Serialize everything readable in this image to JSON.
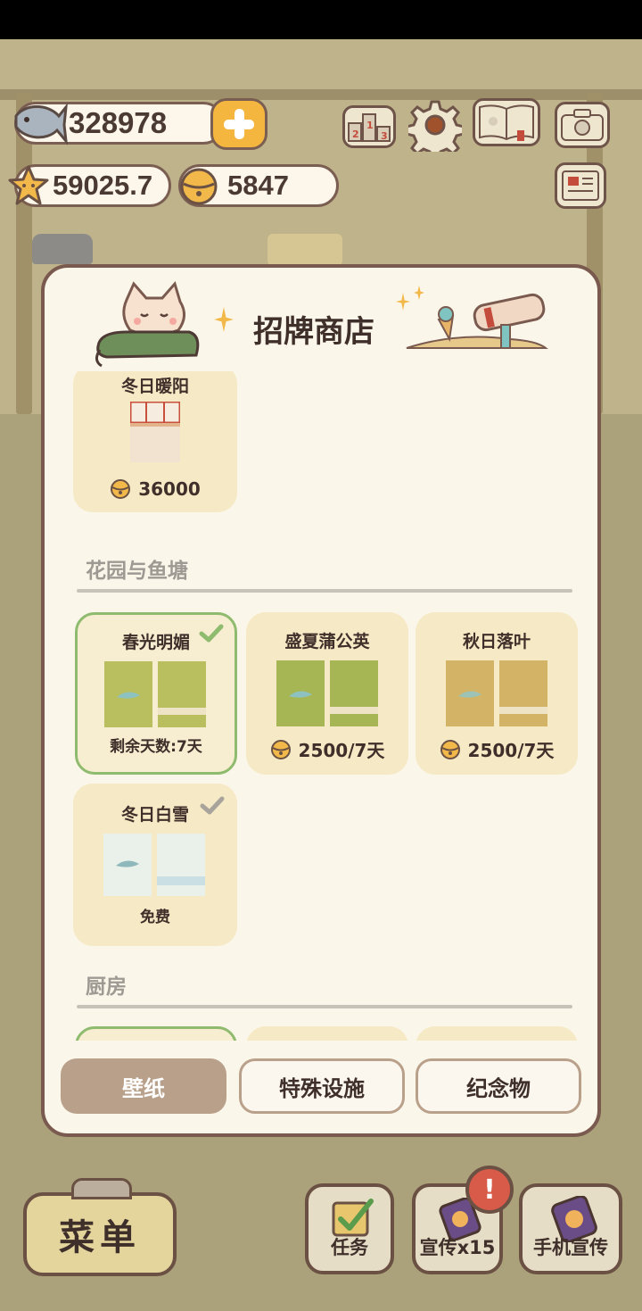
{
  "hud": {
    "fish_amount": "328978",
    "star_amount": "59025.7",
    "bell_amount": "5847"
  },
  "shop": {
    "title": "招牌商店",
    "top_card": {
      "name": "冬日暖阳",
      "price": "36000"
    },
    "sections": [
      {
        "title": "花园与鱼塘",
        "items": [
          {
            "name": "春光明媚",
            "status": "剩余天数:7天",
            "selected": true
          },
          {
            "name": "盛夏蒲公英",
            "price": "2500/7天"
          },
          {
            "name": "秋日落叶",
            "price": "2500/7天"
          },
          {
            "name": "冬日白雪",
            "status": "免费",
            "owned": true
          }
        ]
      },
      {
        "title": "厨房"
      }
    ],
    "tabs": [
      "壁纸",
      "特殊设施",
      "纪念物"
    ],
    "active_tab": "壁纸"
  },
  "bottom_bar": {
    "menu": "菜单",
    "task": "任务",
    "promo": "宣传x15",
    "phone_promo": "手机宣传",
    "alert": "!"
  },
  "colors": {
    "panel_bg": "#fbf6ea",
    "panel_border": "#7a5a4f",
    "card_bg": "#f6e9c5",
    "selected_border": "#8fbb6e",
    "tab_active": "#b9a08a",
    "coin_yellow": "#f4b63f"
  },
  "icons": [
    "fish-icon",
    "plus-icon",
    "star-icon",
    "bell-icon",
    "ranking-icon",
    "gear-icon",
    "album-icon",
    "camera-icon",
    "newspaper-icon",
    "check-icon",
    "task-icon",
    "promo-icon",
    "phone-icon"
  ]
}
